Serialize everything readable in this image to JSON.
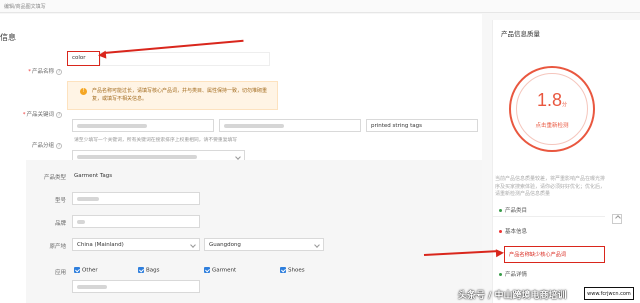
{
  "topbar": {
    "title": "编辑/商品图文填写"
  },
  "section": {
    "title": "信息"
  },
  "form": {
    "name": {
      "label": "产品名称",
      "value": "color"
    },
    "warning": "产品名称可能过长，请填写核心产品词，并与类目、属性保持一致，切勿堆砌重复，或填写不相关信息。",
    "keywords": {
      "label": "产品关键词",
      "value3": "printed string tags",
      "hint": "请至少填写一个关键词，所有关键词在搜索排序上权重相同，请不要重复填写"
    },
    "group": {
      "label": "产品分组"
    },
    "type": {
      "label": "产品类型",
      "value": "Garment Tags"
    },
    "model": {
      "label": "型号"
    },
    "brand": {
      "label": "品牌"
    },
    "origin": {
      "label": "原产地",
      "country": "China (Mainland)",
      "province": "Guangdong"
    },
    "use": {
      "label": "应用",
      "options": [
        {
          "label": "Other"
        },
        {
          "label": "Bags"
        },
        {
          "label": "Garment"
        },
        {
          "label": "Shoes"
        }
      ]
    }
  },
  "side": {
    "title": "产品信息质量",
    "score": "1.8",
    "score_unit": "分",
    "recheck": "点击重新检测",
    "desc": "当前产品信息质量较差，将严重影响产品在曝光排序及买家搜索体验，请你必须好好优化；优化后，请重新检测产品信息质量",
    "items": [
      {
        "label": "产品类目"
      },
      {
        "label": "基本信息"
      },
      {
        "label": "产品详情"
      }
    ],
    "highlight": "产品名称缺少核心产品词"
  },
  "watermark": "头条号 / 中山跨境电商培训",
  "stamp": "www.fcrjwcn.com",
  "colors": {
    "accent": "#d9261c",
    "score": "#e9573f",
    "checkbox": "#2f7fdd"
  }
}
